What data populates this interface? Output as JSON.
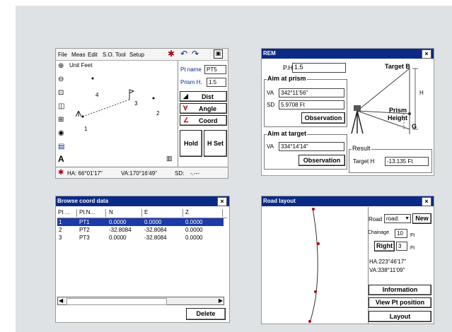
{
  "survey": {
    "menu": [
      "File",
      "Meas",
      "Edit",
      "S.O.",
      "Tool",
      "Setup"
    ],
    "unit_label": "Unit Feet",
    "points": [
      "1",
      "2",
      "3",
      "4"
    ],
    "pt_name_label": "Pt name",
    "pt_name_value": "PT5",
    "prism_label": "Prism H.",
    "prism_value": "1.5",
    "dist_label": "Dist",
    "angle_label": "Angle",
    "coord_label": "Coord",
    "hold_label": "Hold",
    "hset_label": "H Set",
    "status_ha": "HA: 66°01'17\"",
    "status_va": "VA:170°16'49\"",
    "status_sd": "SD:",
    "status_sd_value": "-.---"
  },
  "rem": {
    "title": "REM",
    "pht_label": "P.Ht",
    "pht_value": "1.5",
    "aim_prism_title": "Aim at prism",
    "va_label": "VA",
    "va_value": "342°11'56\"",
    "sd_label": "SD",
    "sd_value": "5.9708 Ft",
    "observation_label": "Observation",
    "aim_target_title": "Aim at target",
    "va2_value": "334°14'14\"",
    "observation2_label": "Observation",
    "diagram_target": "Target B",
    "diagram_h": "H",
    "diagram_prism": "Prism",
    "diagram_height": "Height",
    "diagram_g": "G",
    "result_title": "Result",
    "target_h_label": "Target H",
    "target_h_value": "-13.135 Ft"
  },
  "browse": {
    "title": "Browse coord data",
    "columns": [
      "Pt ...",
      "Pt N...",
      "N",
      "E",
      "Z"
    ],
    "rows": [
      [
        "1",
        "PT1",
        "0.0000",
        "0.0000",
        "0.0000"
      ],
      [
        "2",
        "PT2",
        "-32.8084",
        "-32.8084",
        "0.0000"
      ],
      [
        "3",
        "PT3",
        "0.0000",
        "-32.8084",
        "0.0000"
      ]
    ],
    "delete_label": "Delete"
  },
  "road": {
    "title": "Road layout",
    "road_label": "Road",
    "road_value": "road:",
    "new_label": "New",
    "chainage_label": "Chainage",
    "chainage_value": "10",
    "unit1": "Ft",
    "right_label": "Right",
    "right_value": "3",
    "unit2": "Ft",
    "ha_text": "HA:223°46'17\"",
    "va_text": "VA:338°11'09\"",
    "information_label": "Information",
    "view_pt_label": "View Pt position",
    "layout_label": "Layout"
  },
  "colors": {
    "title_bar": "#0a2a86",
    "selection": "#1c3aa8",
    "point_marker": "#b00010"
  }
}
